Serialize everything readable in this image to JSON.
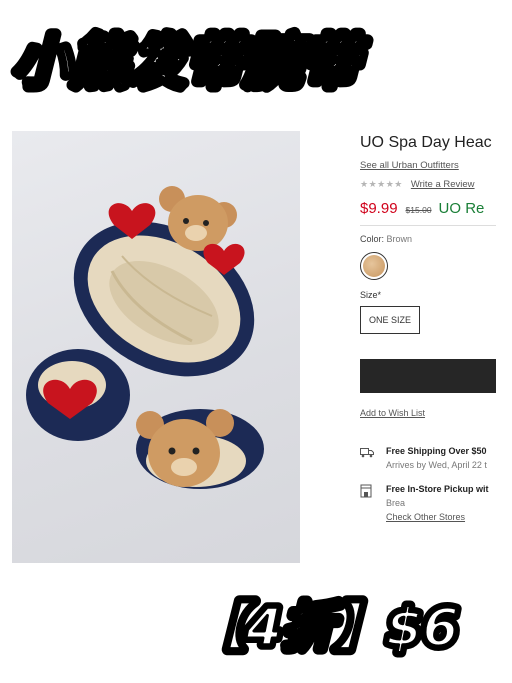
{
  "headline": "小熊发带腕带",
  "promo": "【4折】$6",
  "product": {
    "title": "UO Spa Day Heac",
    "brand_link": "See all Urban Outfitters",
    "stars": "★★★★★",
    "review_link": "Write a Review",
    "price": "$9.99",
    "original_price": "$15.00",
    "uo_label": "UO Re",
    "color_label": "Color:",
    "color_value": "Brown",
    "size_label": "Size*",
    "size_option": "ONE SIZE",
    "wishlist": "Add to Wish List",
    "shipping_title": "Free Shipping Over $50",
    "shipping_sub": "Arrives by Wed, April 22 t",
    "pickup_title": "Free In-Store Pickup wit",
    "pickup_store": "Brea",
    "pickup_link": "Check Other Stores"
  },
  "colors": {
    "price": "#d0021b",
    "uo": "#1a7f37",
    "button": "#262626",
    "navy": "#1c2a55",
    "cream": "#e8dcc3"
  },
  "icons": [
    "truck-icon",
    "store-icon"
  ]
}
